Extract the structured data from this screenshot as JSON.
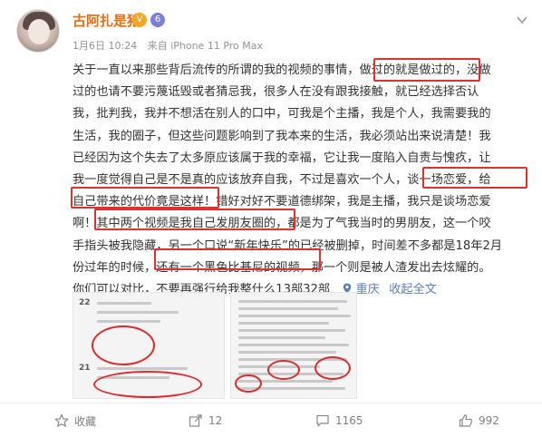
{
  "user": {
    "name": "古阿扎是猪",
    "badge_vip": "V",
    "badge_level": "6"
  },
  "meta": {
    "date": "1月6日 10:24",
    "source": "来自 iPhone 11 Pro Max"
  },
  "post": {
    "lines": [
      "关于一直以来那些背后流传的所谓的我的视频的事情，做过的就是做过的，没做",
      "过的也请不要污蔑诋毁或者猜忌我，很多人在没有跟我接触，就已经选择否认",
      "我，批判我，我并不想活在别人的口中，可我是个主播，我是个人，我需要我的",
      "生活，我的圈子，但这些问题影响到了我本来的生活，我必须站出来说清楚！我",
      "已经因为这个失去了太多原应该属于我的幸福，它让我一度陷入自责与愧疚，让",
      "我一度觉得自己是不是真的应该放弃自我，不过是喜欢一个人，谈一场恋爱，给",
      "自己带来的代价竟是这样！错好对好不要道德绑架，我是主播，我只是谈场恋爱",
      "啊！其中两个视频是我自己发朋友圈的，都是为了气我当时的男朋友，这一个咬",
      "手指头被我隐藏，另一个口说“新年快乐”的已经被删掉，时间差不多都是18年2月",
      "份过年的时候，还有一个黑色比基尼的视频，那一个则是被人渣发出去炫耀的。"
    ],
    "last_line": "你们可以对比，不要再强行给我整什么13部32部",
    "location": "重庆",
    "collapse": "收起全文"
  },
  "images": {
    "left_labels": [
      "22",
      "21"
    ],
    "right_label": ""
  },
  "actions": {
    "favorite": "收藏",
    "share": "12",
    "comment": "1165",
    "like": "992"
  },
  "colors": {
    "username": "#e86b0f",
    "highlight": "#e03131",
    "link": "#5d7fb6"
  }
}
